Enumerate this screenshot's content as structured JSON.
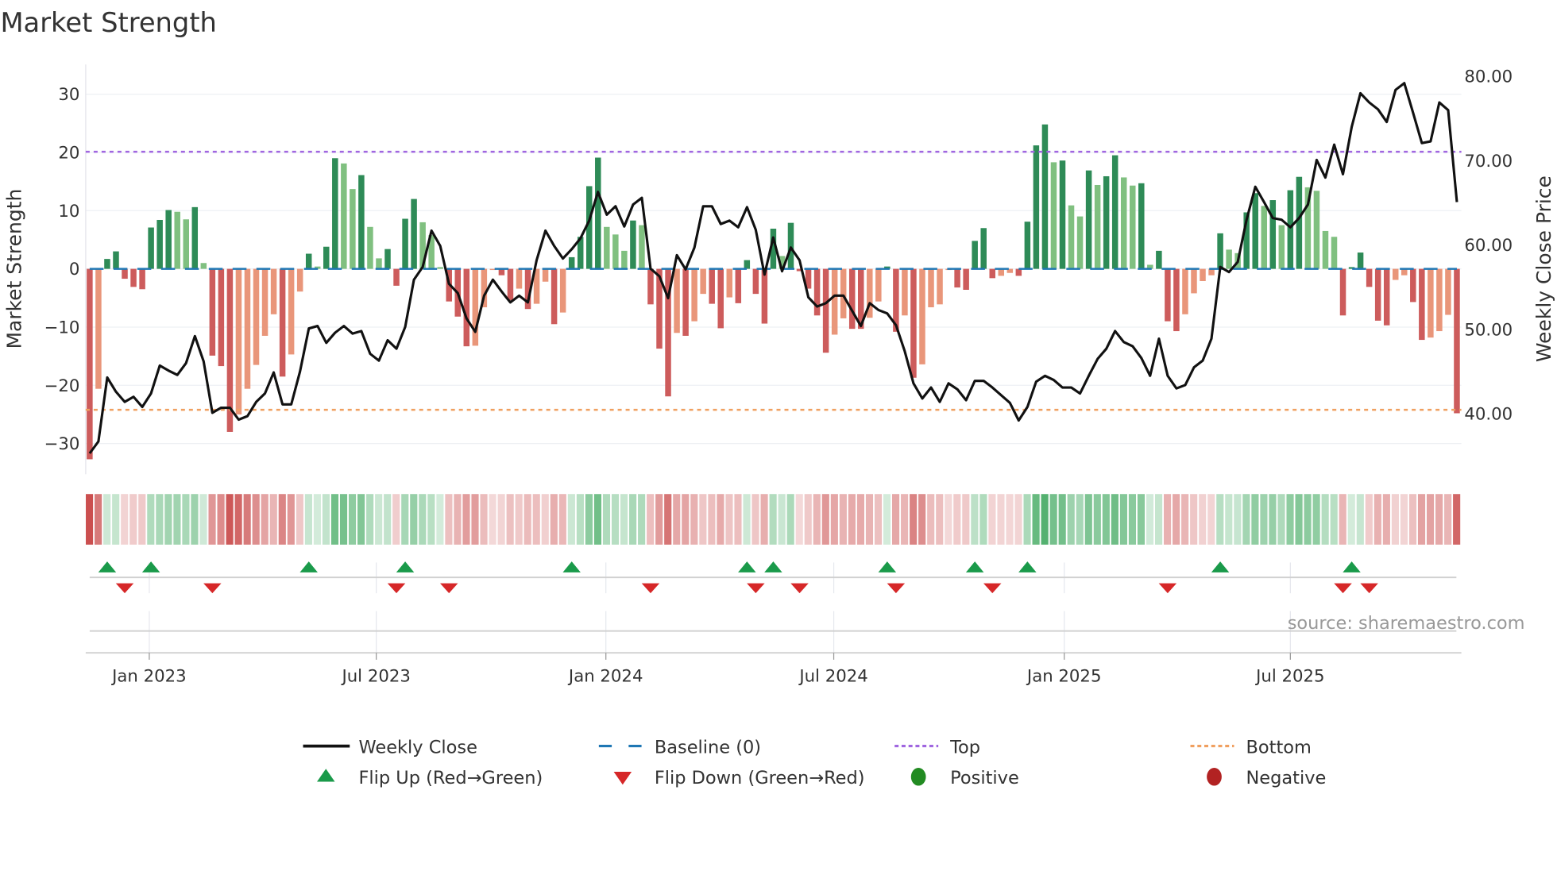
{
  "title": "Market Strength",
  "source": "source: sharemaestro.com",
  "colors": {
    "bar_pos_strong": "#2e8b57",
    "bar_pos_weak": "#80c080",
    "bar_neg_strong": "#cd5c5c",
    "bar_neg_weak": "#e9967a",
    "line": "#111111",
    "baseline": "#1f77b4",
    "top": "#a066e0",
    "bottom": "#f0a060",
    "flip_up": "#1a9a4a",
    "flip_down": "#d62728",
    "positive": "#228b22",
    "negative": "#b22222"
  },
  "legend": {
    "weekly_close": "Weekly Close",
    "baseline": "Baseline (0)",
    "top": "Top",
    "bottom": "Bottom",
    "flip_up": "Flip Up (Red→Green)",
    "flip_down": "Flip Down (Green→Red)",
    "positive": "Positive",
    "negative": "Negative"
  },
  "chart_data": {
    "type": "bar",
    "title": "Market Strength",
    "ylabel": "Market Strength",
    "y2label": "Weekly Close Price",
    "ylim": [
      -34,
      36
    ],
    "y2lim": [
      33.1,
      82.3
    ],
    "yticks": [
      "30",
      "20",
      "10",
      "0",
      "−10",
      "−20",
      "−30"
    ],
    "ytick_values": [
      30,
      20,
      10,
      0,
      -10,
      -20,
      -30
    ],
    "y2ticks": [
      "80.00",
      "70.00",
      "60.00",
      "50.00",
      "40.00"
    ],
    "y2tick_values": [
      80,
      70,
      60,
      50,
      40
    ],
    "xticks": [
      "Jan 2023",
      "Jul 2023",
      "Jan 2024",
      "Jul 2024",
      "Jan 2025",
      "Jul 2025"
    ],
    "xtick_week_index": [
      6.8,
      32.7,
      58.9,
      84.9,
      111.2,
      137.0
    ],
    "top_level": 20.1,
    "bottom_level": -24.2,
    "baseline": 0,
    "strength": [
      -32.7,
      -20.6,
      1.7,
      3,
      -1.7,
      -3.1,
      -3.5,
      7.1,
      8.4,
      10.1,
      9.8,
      8.5,
      10.6,
      1,
      -14.9,
      -16.7,
      -28,
      -25,
      -20.6,
      -16.5,
      -11.5,
      -7.8,
      -18.5,
      -14.7,
      -3.9,
      2.6,
      0.4,
      3.8,
      19,
      18.1,
      13.7,
      16.1,
      7.2,
      1.8,
      3.4,
      -2.9,
      8.6,
      12,
      8,
      5.8,
      0.3,
      -5.6,
      -8.2,
      -13.3,
      -13.2,
      -6.6,
      -0.2,
      -1.1,
      -5.4,
      -3.4,
      -6.9,
      -6,
      -2.2,
      -9.5,
      -7.5,
      2,
      5.5,
      14.2,
      19.1,
      7.2,
      5.9,
      3.1,
      8.3,
      7.5,
      -6.1,
      -13.7,
      -21.9,
      -11,
      -11.5,
      -9,
      -4.3,
      -6,
      -10.2,
      -4.9,
      -5.9,
      1.5,
      -4.3,
      -9.4,
      6.9,
      2.2,
      7.9,
      -0.4,
      -3.4,
      -8,
      -14.4,
      -11.3,
      -8.5,
      -10.3,
      -10.3,
      -8.4,
      -5.6,
      0.4,
      -10.8,
      -8,
      -18.7,
      -16.4,
      -6.6,
      -6.1,
      -0.2,
      -3.2,
      -3.6,
      4.8,
      7,
      -1.6,
      -1.2,
      -0.7,
      -1.2,
      8.1,
      21.2,
      24.8,
      18.3,
      18.6,
      10.9,
      9,
      16.9,
      14.4,
      15.9,
      19.5,
      15.7,
      14.3,
      14.7,
      0.7,
      3.1,
      -9,
      -10.7,
      -7.8,
      -4.2,
      -2.1,
      -1.1,
      6.1,
      3.3,
      2.7,
      9.7,
      13,
      10.8,
      11.8,
      7.5,
      13.5,
      15.8,
      14,
      13.4,
      6.5,
      5.5,
      -8,
      0.3,
      2.8,
      -3.1,
      -8.9,
      -9.7,
      -1.9,
      -1.1,
      -5.7,
      -12.2,
      -11.8,
      -10.7,
      -7.9,
      -24.8
    ],
    "weekly_close": [
      35.3,
      36.7,
      44.3,
      42.6,
      41.4,
      42,
      40.8,
      42.4,
      45.7,
      45.1,
      44.6,
      46,
      49.2,
      46.2,
      40.1,
      40.7,
      40.7,
      39.3,
      39.7,
      41.4,
      42.4,
      44.9,
      41.1,
      41.1,
      45,
      50.1,
      50.4,
      48.4,
      49.6,
      50.4,
      49.5,
      49.8,
      47.1,
      46.3,
      48.7,
      47.7,
      50.3,
      55.9,
      57.4,
      61.7,
      59.9,
      55.4,
      54.3,
      51.3,
      49.7,
      54,
      55.9,
      54.5,
      53.2,
      54,
      53.2,
      58.2,
      61.7,
      59.9,
      58.4,
      59.5,
      60.8,
      62.9,
      66.3,
      63.6,
      64.6,
      62.2,
      64.8,
      65.6,
      57.2,
      56.3,
      53.7,
      58.8,
      57.1,
      59.7,
      64.6,
      64.6,
      62.5,
      62.9,
      62.1,
      64.5,
      61.8,
      56.5,
      60.9,
      56.9,
      59.7,
      58.2,
      53.8,
      52.7,
      53.1,
      54,
      54,
      52.2,
      50.4,
      53.1,
      52.3,
      51.9,
      50.5,
      47.4,
      43.6,
      41.8,
      43.1,
      41.4,
      43.6,
      42.9,
      41.6,
      43.9,
      43.9,
      43.1,
      42.2,
      41.3,
      39.2,
      40.8,
      43.8,
      44.5,
      44,
      43.1,
      43.1,
      42.4,
      44.5,
      46.5,
      47.7,
      49.8,
      48.5,
      48,
      46.6,
      44.5,
      48.9,
      44.5,
      43,
      43.4,
      45.5,
      46.3,
      48.9,
      57.4,
      56.8,
      58,
      63,
      66.9,
      65.1,
      63.2,
      63,
      62.1,
      63.2,
      64.8,
      70.1,
      68,
      71.9,
      68.4,
      74,
      78,
      76.9,
      76.1,
      74.6,
      78.4,
      79.2,
      75.7,
      72.1,
      72.3,
      76.9,
      76,
      65.1
    ],
    "flip_up_week_index": [
      2,
      7,
      25,
      36,
      55,
      75,
      78,
      91,
      101,
      107,
      129,
      144
    ],
    "flip_down_week_index": [
      4,
      14,
      35,
      41,
      64,
      76,
      81,
      92,
      103,
      123,
      143,
      146
    ],
    "grid": true,
    "legend_placement": "bottom"
  }
}
